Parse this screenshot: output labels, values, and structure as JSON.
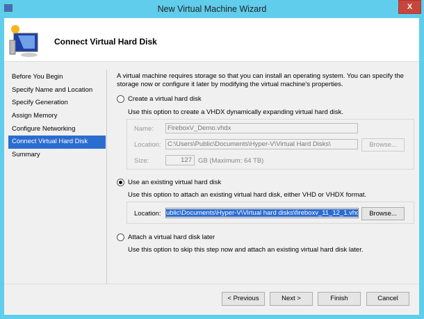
{
  "window": {
    "title": "New Virtual Machine Wizard",
    "close_label": "X"
  },
  "header": {
    "title": "Connect Virtual Hard Disk"
  },
  "nav": {
    "items": [
      {
        "label": "Before You Begin"
      },
      {
        "label": "Specify Name and Location"
      },
      {
        "label": "Specify Generation"
      },
      {
        "label": "Assign Memory"
      },
      {
        "label": "Configure Networking"
      },
      {
        "label": "Connect Virtual Hard Disk",
        "selected": true
      },
      {
        "label": "Summary"
      }
    ]
  },
  "main": {
    "intro": "A virtual machine requires storage so that you can install an operating system. You can specify the storage now or configure it later by modifying the virtual machine's properties.",
    "create": {
      "label": "Create a virtual hard disk",
      "desc": "Use this option to create a VHDX dynamically expanding virtual hard disk.",
      "name_label": "Name:",
      "name_value": "FireboxV_Demo.vhdx",
      "location_label": "Location:",
      "location_value": "C:\\Users\\Public\\Documents\\Hyper-V\\Virtual Hard Disks\\",
      "browse": "Browse...",
      "size_label": "Size:",
      "size_value": "127",
      "size_unit": "GB (Maximum: 64 TB)"
    },
    "existing": {
      "label": "Use an existing virtual hard disk",
      "desc": "Use this option to attach an existing virtual hard disk, either VHD or VHDX format.",
      "location_label": "Location:",
      "location_value": "ublic\\Documents\\Hyper-V\\Virtual hard disks\\fireboxv_11_12_1.vhd",
      "browse": "Browse..."
    },
    "later": {
      "label": "Attach a virtual hard disk later",
      "desc": "Use this option to skip this step now and attach an existing virtual hard disk later."
    },
    "selected_option": "existing"
  },
  "footer": {
    "previous": "< Previous",
    "next": "Next >",
    "finish": "Finish",
    "cancel": "Cancel"
  }
}
